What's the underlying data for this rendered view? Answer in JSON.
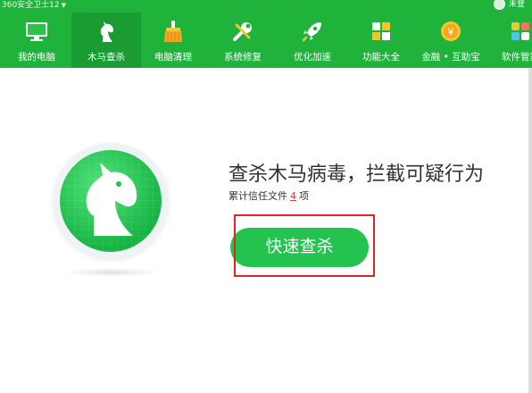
{
  "titlebar": {
    "app_title": "360安全卫士12",
    "user_name": "未登"
  },
  "nav": {
    "items": [
      {
        "label": "我的电脑",
        "icon": "monitor-icon",
        "active": false
      },
      {
        "label": "木马查杀",
        "icon": "horse-icon",
        "active": true
      },
      {
        "label": "电脑清理",
        "icon": "broom-icon",
        "active": false
      },
      {
        "label": "系统修复",
        "icon": "wrench-icon",
        "active": false
      },
      {
        "label": "优化加速",
        "icon": "rocket-icon",
        "active": false
      },
      {
        "label": "功能大全",
        "icon": "grid-icon",
        "active": false
      },
      {
        "label": "金融 • 互助宝",
        "icon": "coin-icon",
        "active": false
      },
      {
        "label": "软件管家",
        "icon": "apps-icon",
        "active": false
      }
    ]
  },
  "main": {
    "headline": "查杀木马病毒，拦截可疑行为",
    "trusted_prefix": "累计信任文件",
    "trusted_count": "4",
    "trusted_suffix": "项",
    "scan_button": "快速查杀"
  },
  "colors": {
    "brand_green": "#1fb33b",
    "active_tab": "#1a9c33",
    "button_green": "#24c24f",
    "highlight_red": "#e02424",
    "count_red": "#e03b2b"
  }
}
